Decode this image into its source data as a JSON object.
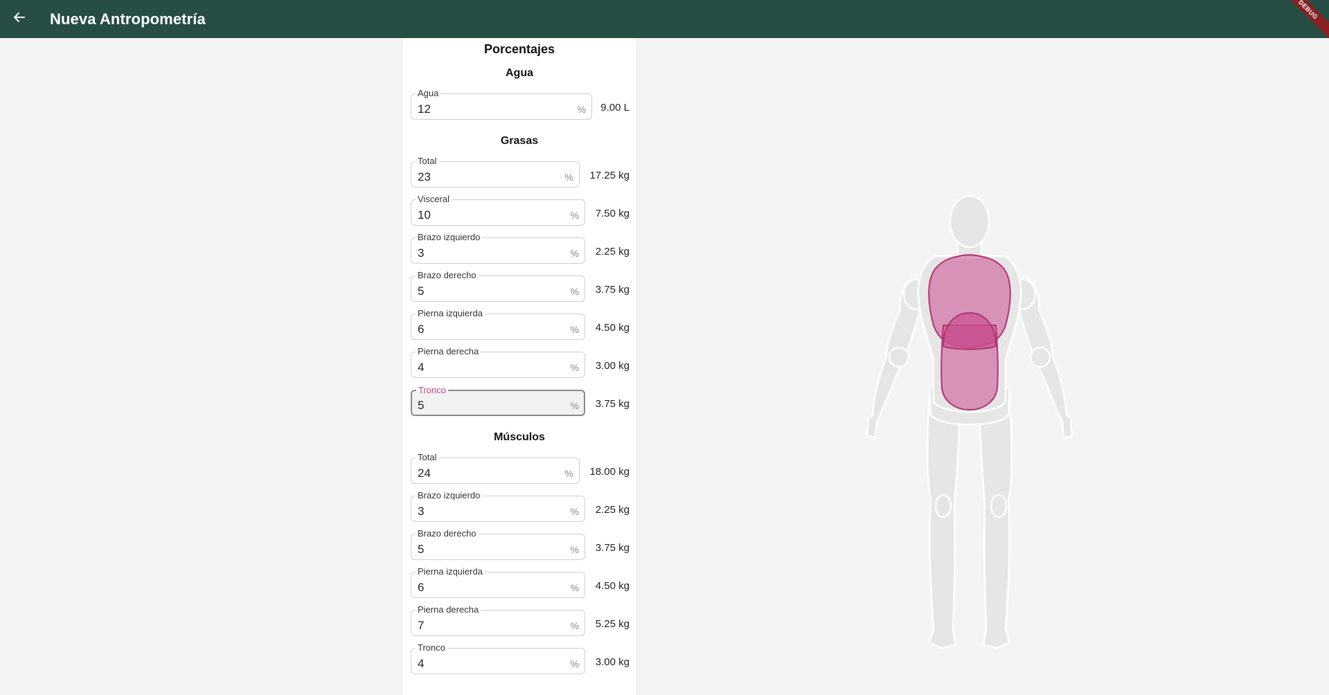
{
  "appbar": {
    "title": "Nueva Antropometría",
    "debug_label": "DEBUG"
  },
  "card": {
    "heading": "Porcentajes",
    "agua": {
      "title": "Agua",
      "fields": [
        {
          "label": "Agua",
          "value": "12",
          "suffix": "%",
          "result": "9.00 L"
        }
      ]
    },
    "grasas": {
      "title": "Grasas",
      "fields": [
        {
          "label": "Total",
          "value": "23",
          "suffix": "%",
          "result": "17.25 kg"
        },
        {
          "label": "Visceral",
          "value": "10",
          "suffix": "%",
          "result": "7.50 kg"
        },
        {
          "label": "Brazo izquierdo",
          "value": "3",
          "suffix": "%",
          "result": "2.25 kg"
        },
        {
          "label": "Brazo derecho",
          "value": "5",
          "suffix": "%",
          "result": "3.75 kg"
        },
        {
          "label": "Pierna izquierda",
          "value": "6",
          "suffix": "%",
          "result": "4.50 kg"
        },
        {
          "label": "Pierna derecha",
          "value": "4",
          "suffix": "%",
          "result": "3.00 kg"
        },
        {
          "label": "Tronco",
          "value": "5",
          "suffix": "%",
          "result": "3.75 kg"
        }
      ]
    },
    "musculos": {
      "title": "Músculos",
      "fields": [
        {
          "label": "Total",
          "value": "24",
          "suffix": "%",
          "result": "18.00 kg"
        },
        {
          "label": "Brazo izquierdo",
          "value": "3",
          "suffix": "%",
          "result": "2.25 kg"
        },
        {
          "label": "Brazo derecho",
          "value": "5",
          "suffix": "%",
          "result": "3.75 kg"
        },
        {
          "label": "Pierna izquierda",
          "value": "6",
          "suffix": "%",
          "result": "4.50 kg"
        },
        {
          "label": "Pierna derecha",
          "value": "7",
          "suffix": "%",
          "result": "5.25 kg"
        },
        {
          "label": "Tronco",
          "value": "4",
          "suffix": "%",
          "result": "3.00 kg"
        }
      ]
    }
  },
  "colors": {
    "appbar": "#264e44",
    "focus_label": "#c3447c",
    "highlight": "#c94f8f",
    "body_fill": "#e6e6e6"
  }
}
